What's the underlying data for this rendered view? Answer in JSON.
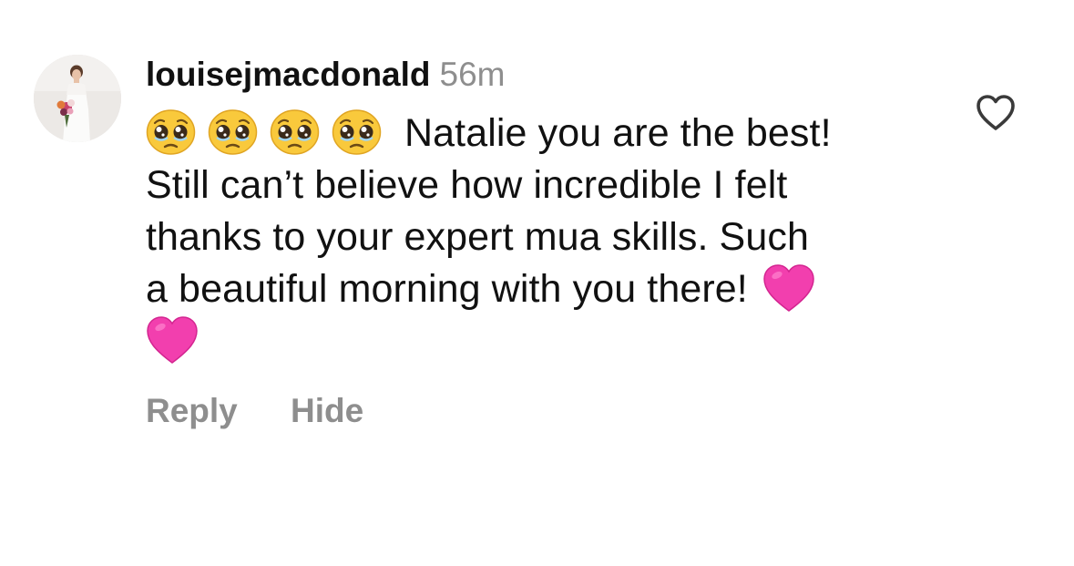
{
  "comment": {
    "username": "louisejmacdonald",
    "time": "56m",
    "emojis": [
      "pleading-face",
      "pleading-face",
      "pleading-face",
      "pleading-face"
    ],
    "lines": [
      "Natalie you are the best!",
      "Still can’t believe how incredible I felt",
      "thanks to your expert mua skills. Such",
      "a beautiful morning with you there!"
    ],
    "trailing_emojis": [
      "pink-heart",
      "pink-heart"
    ]
  },
  "actions": {
    "reply_label": "Reply",
    "hide_label": "Hide"
  },
  "icons": {
    "like": "heart-outline-icon"
  },
  "colors": {
    "text": "#111111",
    "secondary": "#8e8e8e",
    "heart_pink": "#f23fae",
    "emoji_yellow": "#f9c93c",
    "background": "#ffffff"
  }
}
